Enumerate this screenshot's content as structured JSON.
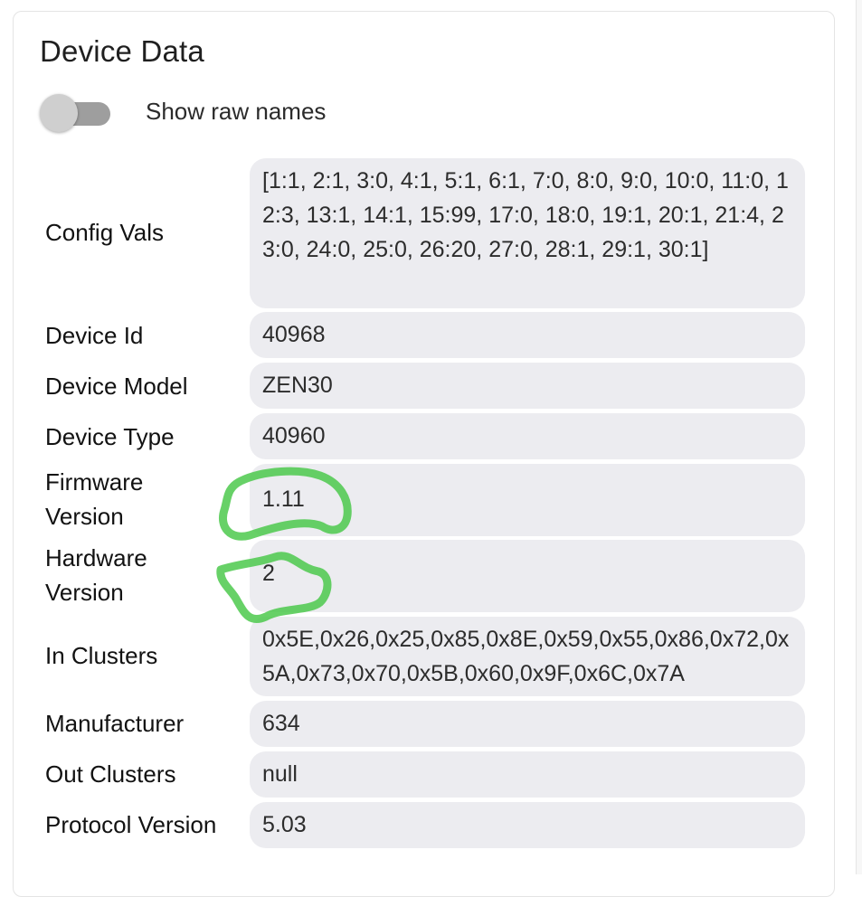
{
  "card": {
    "title": "Device Data",
    "toggle": {
      "label": "Show raw names",
      "checked": false
    }
  },
  "rows": [
    {
      "label": "Config Vals",
      "value": "[1:1, 2:1, 3:0, 4:1, 5:1, 6:1, 7:0, 8:0, 9:0, 10:0, 11:0, 12:3, 13:1, 14:1, 15:99, 17:0, 18:0, 19:1, 20:1, 21:4, 23:0, 24:0, 25:0, 26:20, 27:0, 28:1, 29:1, 30:1]"
    },
    {
      "label": "Device Id",
      "value": "40968"
    },
    {
      "label": "Device Model",
      "value": "ZEN30"
    },
    {
      "label": "Device Type",
      "value": "40960"
    },
    {
      "label": "Firmware Version",
      "value": "1.11"
    },
    {
      "label": "Hardware Version",
      "value": "2"
    },
    {
      "label": "In Clusters",
      "value": "0x5E,0x26,0x25,0x85,0x8E,0x59,0x55,0x86,0x72,0x5A,0x73,0x70,0x5B,0x60,0x9F,0x6C,0x7A"
    },
    {
      "label": "Manufacturer",
      "value": "634"
    },
    {
      "label": "Out Clusters",
      "value": "null"
    },
    {
      "label": "Protocol Version",
      "value": "5.03"
    }
  ],
  "colors": {
    "value_bg": "#ececf0",
    "highlight_stroke": "#4cc94c"
  }
}
